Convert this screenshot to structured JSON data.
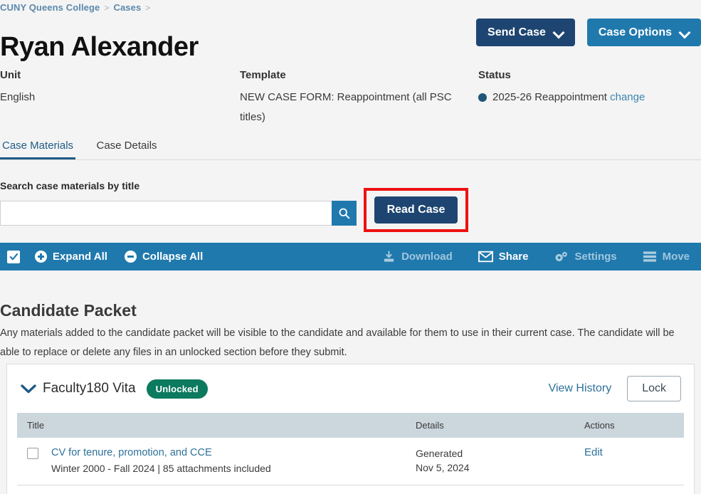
{
  "breadcrumb": {
    "items": [
      {
        "label": "CUNY Queens College"
      },
      {
        "label": "Cases"
      }
    ],
    "separator": ">"
  },
  "header": {
    "title": "Ryan Alexander",
    "send_case_label": "Send Case",
    "case_options_label": "Case Options"
  },
  "meta": {
    "unit": {
      "label": "Unit",
      "value": "English"
    },
    "template": {
      "label": "Template",
      "value": "NEW CASE FORM: Reappointment (all PSC titles)"
    },
    "status": {
      "label": "Status",
      "value": "2025-26 Reappointment",
      "change_label": "change",
      "dot_color": "#1f5578"
    }
  },
  "tabs": [
    {
      "label": "Case Materials",
      "active": true
    },
    {
      "label": "Case Details",
      "active": false
    }
  ],
  "search": {
    "label": "Search case materials by title",
    "value": "",
    "placeholder": "",
    "button_icon": "search-icon"
  },
  "read_case": {
    "label": "Read Case",
    "highlight_color": "#ee1111"
  },
  "toolbar": {
    "background": "#2079ad",
    "select_all_checked": true,
    "expand_all_label": "Expand All",
    "collapse_all_label": "Collapse All",
    "actions": [
      {
        "label": "Download",
        "icon": "download-icon",
        "enabled": false
      },
      {
        "label": "Share",
        "icon": "envelope-icon",
        "enabled": true
      },
      {
        "label": "Settings",
        "icon": "gears-icon",
        "enabled": false
      },
      {
        "label": "Move",
        "icon": "move-rows-icon",
        "enabled": false
      }
    ]
  },
  "section": {
    "title": "Candidate Packet",
    "description": "Any materials added to the candidate packet will be visible to the candidate and available for them to use in their current case. The candidate will be able to replace or delete any files in an unlocked section before they submit."
  },
  "packet_card": {
    "name": "Faculty180 Vita",
    "badge": "Unlocked",
    "badge_color": "#0b7a5f",
    "view_history_label": "View History",
    "lock_label": "Lock",
    "table": {
      "columns": [
        "Title",
        "Details",
        "Actions"
      ],
      "rows": [
        {
          "title": "CV for tenure, promotion, and CCE",
          "subtitle": "Winter 2000 - Fall 2024 | 85 attachments included",
          "details_line1": "Generated",
          "details_line2": "Nov 5, 2024",
          "action": "Edit",
          "checked": false
        }
      ]
    }
  }
}
